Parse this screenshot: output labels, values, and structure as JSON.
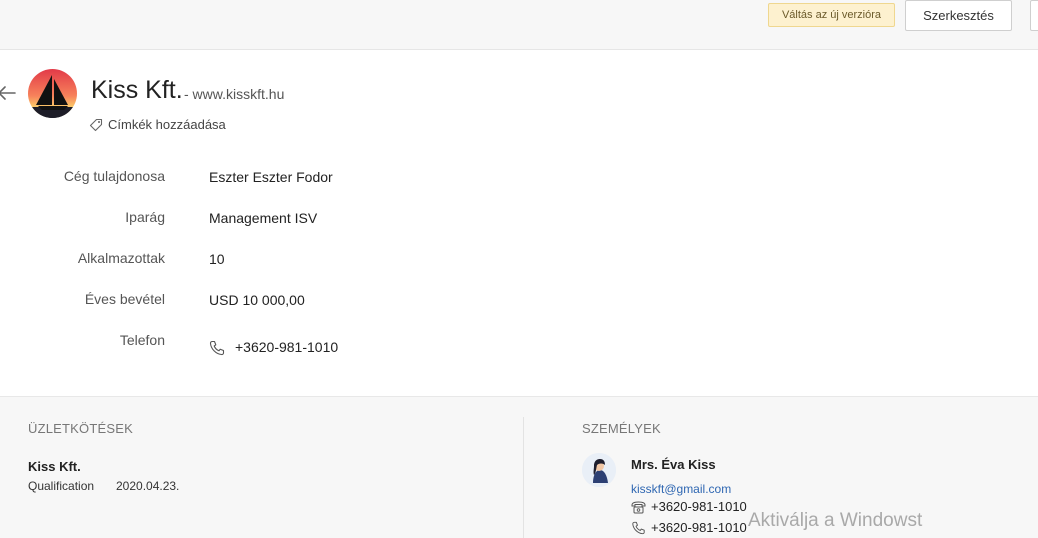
{
  "toolbar": {
    "switch_version_label": "Váltás az új verzióra",
    "edit_label": "Szerkesztés"
  },
  "company": {
    "name": "Kiss Kft.",
    "website": "- www.kisskft.hu",
    "add_tags_label": "Címkék hozzáadása"
  },
  "fields": [
    {
      "label": "Cég tulajdonosa",
      "value": "Eszter Eszter Fodor"
    },
    {
      "label": "Iparág",
      "value": "Management ISV"
    },
    {
      "label": "Alkalmazottak",
      "value": "10"
    },
    {
      "label": "Éves bevétel",
      "value": "USD 10 000,00"
    },
    {
      "label": "Telefon",
      "value": "+3620-981-1010"
    }
  ],
  "deals": {
    "title": "ÜZLETKÖTÉSEK",
    "items": [
      {
        "name": "Kiss Kft.",
        "stage": "Qualification",
        "date": "2020.04.23."
      }
    ]
  },
  "people": {
    "title": "SZEMÉLYEK",
    "items": [
      {
        "name": "Mrs. Éva Kiss",
        "email": "kisskft@gmail.com",
        "phone": "+3620-981-1010",
        "mobile": "+3620-981-1010"
      }
    ]
  },
  "watermark": "Aktiválja a Windowst"
}
